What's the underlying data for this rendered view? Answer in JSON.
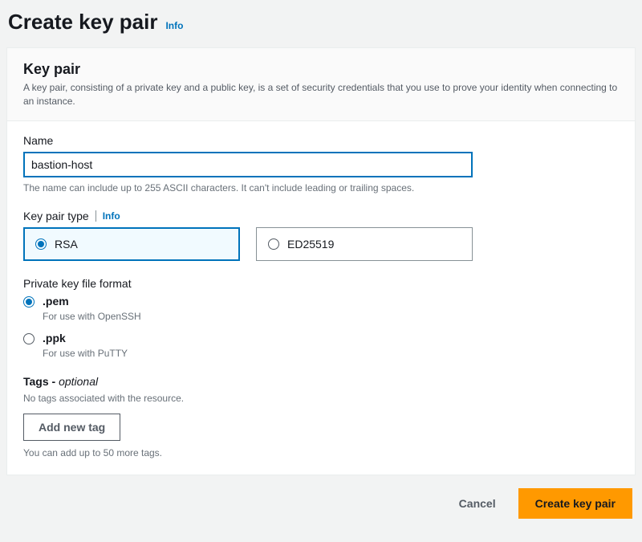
{
  "page": {
    "title": "Create key pair",
    "info": "Info"
  },
  "panel": {
    "title": "Key pair",
    "description": "A key pair, consisting of a private key and a public key, is a set of security credentials that you use to prove your identity when connecting to an instance."
  },
  "name": {
    "label": "Name",
    "value": "bastion-host",
    "hint": "The name can include up to 255 ASCII characters. It can't include leading or trailing spaces."
  },
  "keyPairType": {
    "label": "Key pair type",
    "info": "Info",
    "options": [
      "RSA",
      "ED25519"
    ],
    "selected": "RSA"
  },
  "fileFormat": {
    "label": "Private key file format",
    "options": [
      {
        "value": ".pem",
        "desc": "For use with OpenSSH"
      },
      {
        "value": ".ppk",
        "desc": "For use with PuTTY"
      }
    ],
    "selected": ".pem"
  },
  "tags": {
    "label_prefix": "Tags - ",
    "label_suffix": "optional",
    "empty": "No tags associated with the resource.",
    "addButton": "Add new tag",
    "limit": "You can add up to 50 more tags."
  },
  "actions": {
    "cancel": "Cancel",
    "submit": "Create key pair"
  }
}
